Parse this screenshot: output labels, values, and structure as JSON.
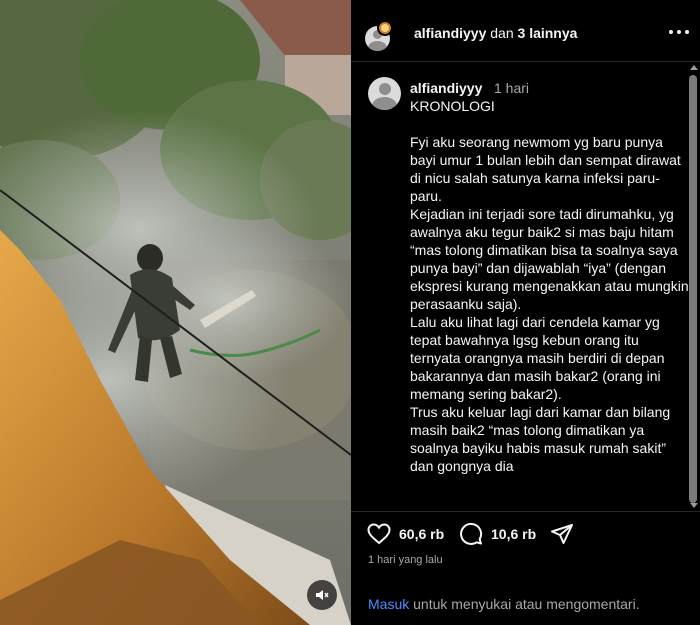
{
  "media": {
    "sound_icon": "speaker-muted-icon"
  },
  "header": {
    "username": "alfiandiyyy",
    "connector": "dan",
    "others": "3 lainnya",
    "more_icon": "more-dots-icon"
  },
  "comment": {
    "username": "alfiandiyyy",
    "time": "1 hari",
    "heading": "KRONOLOGI",
    "paragraphs": [
      "Fyi aku seorang newmom yg baru punya bayi umur 1 bulan lebih dan sempat dirawat di nicu salah satunya karna infeksi paru-paru.",
      "Kejadian ini terjadi sore tadi dirumahku, yg awalnya aku tegur baik2 si mas baju hitam “mas tolong dimatikan bisa ta soalnya saya punya bayi” dan dijawablah “iya” (dengan ekspresi kurang mengenakkan atau mungkin perasaanku saja).",
      "Lalu aku lihat lagi dari cendela kamar yg tepat bawahnya lgsg kebun orang itu ternyata orangnya masih berdiri di depan bakarannya dan masih bakar2 (orang ini memang sering bakar2).",
      "Trus aku keluar lagi dari kamar dan bilang masih baik2 “mas tolong dimatikan ya soalnya bayiku habis masuk rumah sakit” dan gongnya dia"
    ]
  },
  "actions": {
    "like_count": "60,6 rb",
    "comment_count": "10,6 rb",
    "like_icon": "heart-icon",
    "comment_icon": "comment-bubble-icon",
    "share_icon": "send-icon",
    "posted": "1 hari yang lalu"
  },
  "footer": {
    "login_link": "Masuk",
    "login_text": " untuk menyukai atau mengomentari."
  }
}
